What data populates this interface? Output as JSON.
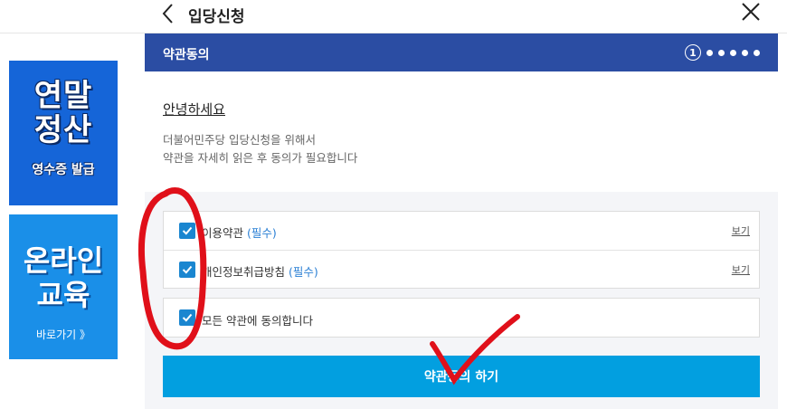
{
  "header": {
    "title": "입당신청"
  },
  "ads": [
    {
      "line1": "연말",
      "line2": "정산",
      "sub": "영수증 발급"
    },
    {
      "line1": "온라인",
      "line2": "교육",
      "sub": "바로가기 》"
    }
  ],
  "panel": {
    "title": "약관동의",
    "current_step": "1",
    "total_steps": 6,
    "greeting": "안녕하세요",
    "desc_line1": "더불어민주당 입당신청을 위해서",
    "desc_line2": "약관을 자세히 읽은 후 동의가 필요합니다"
  },
  "terms": [
    {
      "label": "이용약관",
      "required": "(필수)",
      "view": "보기",
      "checked": true
    },
    {
      "label": "개인정보취급방침",
      "required": "(필수)",
      "view": "보기",
      "checked": true
    }
  ],
  "agree_all": {
    "label": "모든 약관에 동의합니다",
    "checked": true
  },
  "submit_label": "약관동의 하기",
  "colors": {
    "header_bg": "#2b4da3",
    "button_bg": "#029fe0",
    "checkbox": "#1a86d0",
    "annotation": "#e0101a"
  }
}
